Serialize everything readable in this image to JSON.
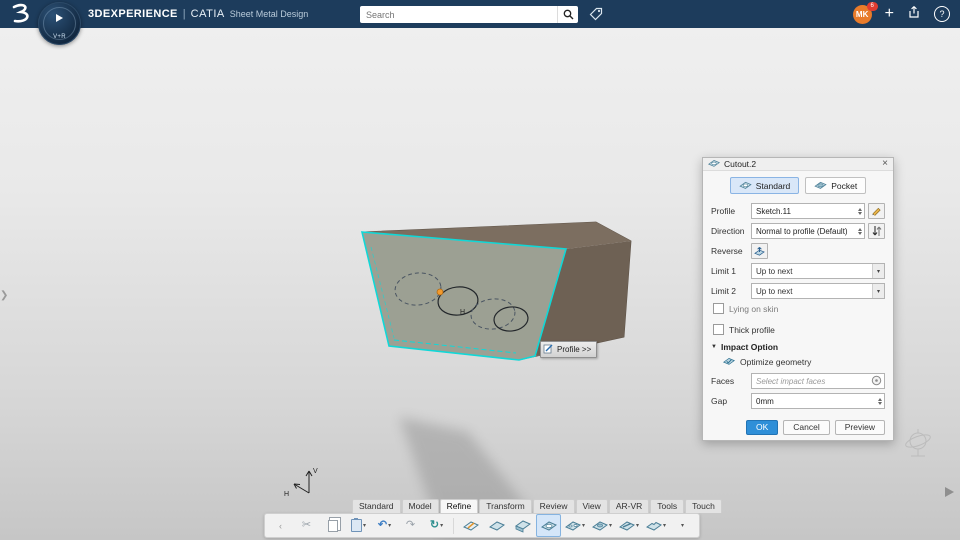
{
  "topbar": {
    "brand": "3DEXPERIENCE",
    "divider": "|",
    "app_name": "CATIA",
    "workbench": "Sheet Metal Design",
    "search": {
      "placeholder": "Search"
    },
    "user": {
      "initials": "MK",
      "badge": "6"
    },
    "actions": {
      "add": "+",
      "help": "?"
    },
    "compass": {
      "version_label": "V+R"
    }
  },
  "viewport": {
    "profile_tooltip": "Profile >>",
    "sketch_axis_v": "V",
    "sketch_axis_h": "H"
  },
  "dialog": {
    "title": "Cutout.2",
    "close_glyph": "×",
    "modes": [
      {
        "label": "Standard",
        "active": true
      },
      {
        "label": "Pocket",
        "active": false
      }
    ],
    "profile_label": "Profile",
    "profile_value": "Sketch.11",
    "direction_label": "Direction",
    "direction_value": "Normal to profile (Default)",
    "reverse_label": "Reverse",
    "limit1_label": "Limit 1",
    "limit1_value": "Up to next",
    "limit2_label": "Limit 2",
    "limit2_value": "Up to next",
    "lying_label": "Lying on skin",
    "thick_label": "Thick profile",
    "impact_section": "Impact Option",
    "optimize_label": "Optimize geometry",
    "faces_label": "Faces",
    "faces_placeholder": "Select impact faces",
    "gap_label": "Gap",
    "gap_value": "0mm",
    "buttons": {
      "ok": "OK",
      "cancel": "Cancel",
      "preview": "Preview"
    }
  },
  "ribbon": {
    "tabs": [
      {
        "label": "Standard"
      },
      {
        "label": "Model"
      },
      {
        "label": "Refine"
      },
      {
        "label": "Transform"
      },
      {
        "label": "Review"
      },
      {
        "label": "View"
      },
      {
        "label": "AR-VR"
      },
      {
        "label": "Tools"
      },
      {
        "label": "Touch"
      }
    ],
    "active_tab": "Refine",
    "toolbar_icons": [
      "collapse-left",
      "cut",
      "copy",
      "paste",
      "undo",
      "redo",
      "update",
      "sketch",
      "wall",
      "flange",
      "cutout",
      "hole",
      "stamp",
      "bead",
      "corner-relief",
      "more"
    ]
  },
  "colors": {
    "topbar_bg": "#1d3c5c",
    "accent_blue": "#2f8fd8",
    "selected_tool_bg": "#d4e6f9",
    "part_edge_teal": "#10d8d8",
    "avatar_orange": "#e87b2a",
    "badge_red": "#e03c31"
  }
}
